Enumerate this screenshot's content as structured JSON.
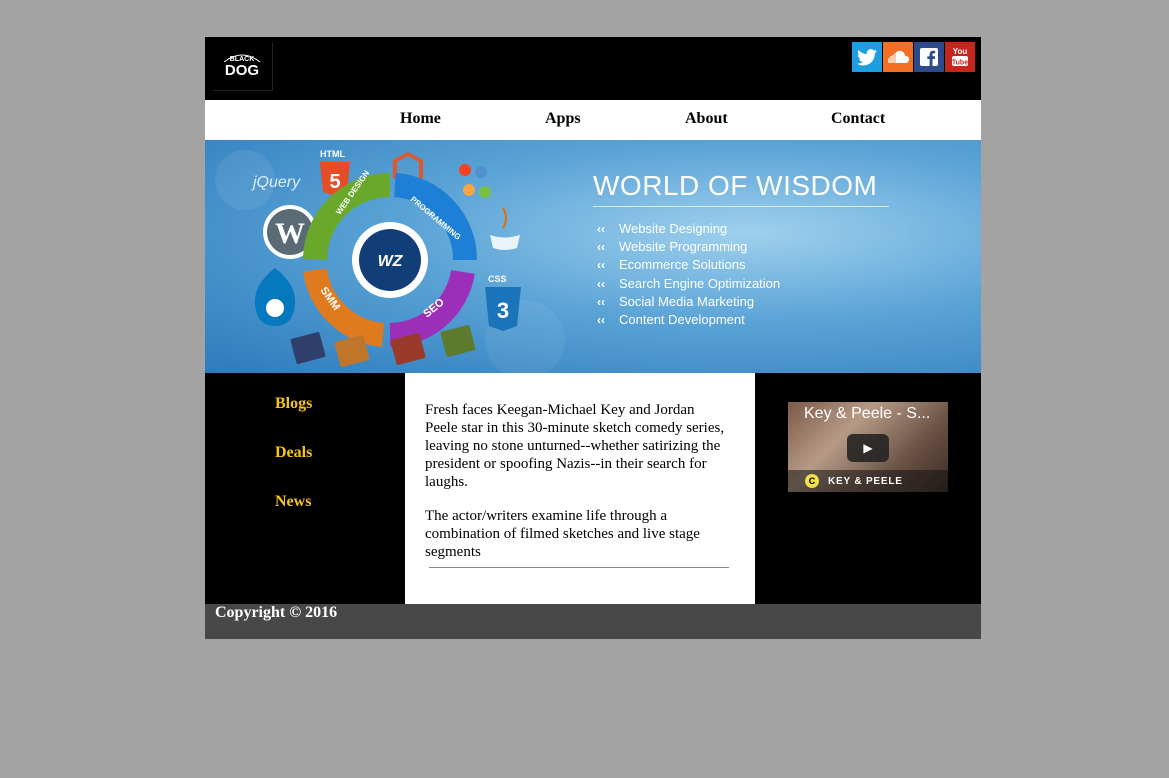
{
  "header": {
    "logo": {
      "icon": "black-dog-logo",
      "text_top": "BLACK",
      "text_main": "DOG"
    },
    "social": [
      {
        "name": "twitter",
        "icon": "twitter-icon",
        "glyph": "t",
        "color": "#1d9ee0"
      },
      {
        "name": "soundcloud",
        "icon": "soundcloud-icon",
        "glyph": "☁",
        "color": "#f26f23"
      },
      {
        "name": "facebook",
        "icon": "facebook-icon",
        "glyph": "f",
        "color": "#2d4a8c"
      },
      {
        "name": "youtube",
        "icon": "youtube-icon",
        "glyph": "You",
        "color": "#c9251f"
      }
    ]
  },
  "nav": {
    "home": "Home",
    "apps": "Apps",
    "about": "About",
    "contact": "Contact"
  },
  "banner": {
    "title": "WORLD OF WISDOM",
    "services": [
      "Website Designing",
      "Website Programming",
      "Ecommerce Solutions",
      "Search Engine Optimization",
      "Social Media Marketing",
      "Content Development"
    ],
    "graphic_labels": {
      "jquery": "jQuery",
      "html": "HTML",
      "css": "CSS",
      "web_design": "WEB DESIGN",
      "programming": "PROGRAMMING",
      "seo": "SEO",
      "smm": "SMM",
      "center": "WZ"
    }
  },
  "sidebar": {
    "blogs": "Blogs",
    "deals": "Deals",
    "news": "News"
  },
  "main": {
    "paragraph_1": "Fresh faces Keegan-Michael Key and Jordan Peele star in this 30-minute sketch comedy series, leaving no stone unturned--whether satirizing the president or spoofing Nazis--in their search for laughs.",
    "paragraph_2": "The actor/writers examine life through a combination of filmed sketches and live stage segments"
  },
  "video": {
    "title": "Key & Peele - S...",
    "channel": "KEY & PEELE",
    "play_icon": "play-icon"
  },
  "footer": {
    "copyright": "Copyright © 2016"
  },
  "colors": {
    "page_bg": "#a3a3a3",
    "header_bg": "#000000",
    "sidebar_link": "#f5c518",
    "footer_bg": "#484848"
  }
}
